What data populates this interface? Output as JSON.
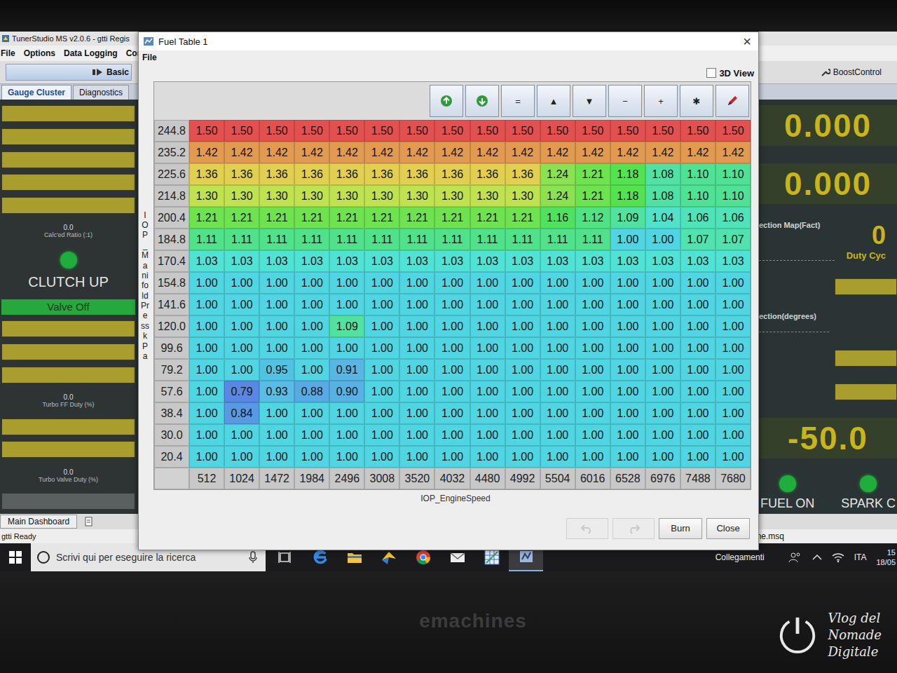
{
  "main_window": {
    "title": "TunerStudio MS v2.0.6 - gtti Regis",
    "menu": [
      "File",
      "Options",
      "Data Logging",
      "Com"
    ],
    "toolbar": {
      "left": "Basic",
      "right": "BoostControl"
    },
    "tabs": [
      {
        "label": "Gauge Cluster",
        "selected": true
      },
      {
        "label": "Diagnostics",
        "selected": false
      }
    ],
    "left_gauges": [
      {
        "kind": "bar"
      },
      {
        "kind": "bar"
      },
      {
        "kind": "bar"
      },
      {
        "kind": "bar"
      },
      {
        "kind": "bar"
      },
      {
        "kind": "readout",
        "value": "0.0",
        "label": "Calc'ed Ratio (:1)"
      },
      {
        "kind": "indicator",
        "label": "CLUTCH UP",
        "on": true
      },
      {
        "kind": "button",
        "label": "Valve Off",
        "on": true
      },
      {
        "kind": "bar"
      },
      {
        "kind": "bar"
      },
      {
        "kind": "bar"
      },
      {
        "kind": "readout",
        "value": "0.0",
        "label": "Turbo FF Duty (%)"
      },
      {
        "kind": "bar"
      },
      {
        "kind": "bar"
      },
      {
        "kind": "readout",
        "value": "0.0",
        "label": "Turbo Valve Duty (%)"
      },
      {
        "kind": "slider"
      }
    ],
    "right_gauges": [
      {
        "kind": "big",
        "value": "0.000"
      },
      {
        "kind": "big",
        "value": "0.000"
      },
      {
        "kind": "pair",
        "label": "ection Map(Fact)",
        "value": "0",
        "sub": "Duty Cyc"
      },
      {
        "kind": "bar"
      },
      {
        "kind": "label",
        "label": "ection(degrees)"
      },
      {
        "kind": "bar"
      },
      {
        "kind": "bar"
      },
      {
        "kind": "big",
        "value": "-50.0"
      },
      {
        "kind": "lights",
        "items": [
          {
            "label": "FUEL ON",
            "on": true
          },
          {
            "label": "SPARK C",
            "on": true
          }
        ]
      }
    ],
    "bottom_tab": "Main Dashboard",
    "status": "gtti Ready",
    "file_name": "une.msq"
  },
  "dialog": {
    "title": "Fuel Table 1",
    "close": "×",
    "menu": [
      "File"
    ],
    "view_3d": {
      "label": "3D View",
      "checked": false
    },
    "tools": [
      {
        "kind": "upload"
      },
      {
        "kind": "download"
      },
      {
        "kind": "glyph",
        "text": "="
      },
      {
        "kind": "glyph",
        "text": "▲"
      },
      {
        "kind": "glyph",
        "text": "▼"
      },
      {
        "kind": "glyph",
        "text": "−"
      },
      {
        "kind": "glyph",
        "text": "+"
      },
      {
        "kind": "glyph",
        "text": "✱"
      },
      {
        "kind": "edit"
      }
    ],
    "table": {
      "y_label": "IOP_ManifoldPress kPa",
      "x_label": "IOP_EngineSpeed",
      "columns": [
        "512",
        "1024",
        "1472",
        "1984",
        "2496",
        "3008",
        "3520",
        "4032",
        "4480",
        "4992",
        "5504",
        "6016",
        "6528",
        "6976",
        "7488",
        "7680"
      ],
      "rows": [
        {
          "label": "244.8",
          "cells": [
            "1.50",
            "1.50",
            "1.50",
            "1.50",
            "1.50",
            "1.50",
            "1.50",
            "1.50",
            "1.50",
            "1.50",
            "1.50",
            "1.50",
            "1.50",
            "1.50",
            "1.50",
            "1.50"
          ]
        },
        {
          "label": "235.2",
          "cells": [
            "1.42",
            "1.42",
            "1.42",
            "1.42",
            "1.42",
            "1.42",
            "1.42",
            "1.42",
            "1.42",
            "1.42",
            "1.42",
            "1.42",
            "1.42",
            "1.42",
            "1.42",
            "1.42"
          ]
        },
        {
          "label": "225.6",
          "cells": [
            "1.36",
            "1.36",
            "1.36",
            "1.36",
            "1.36",
            "1.36",
            "1.36",
            "1.36",
            "1.36",
            "1.36",
            "1.24",
            "1.21",
            "1.18",
            "1.08",
            "1.10",
            "1.10"
          ]
        },
        {
          "label": "214.8",
          "cells": [
            "1.30",
            "1.30",
            "1.30",
            "1.30",
            "1.30",
            "1.30",
            "1.30",
            "1.30",
            "1.30",
            "1.30",
            "1.24",
            "1.21",
            "1.18",
            "1.08",
            "1.10",
            "1.10"
          ]
        },
        {
          "label": "200.4",
          "cells": [
            "1.21",
            "1.21",
            "1.21",
            "1.21",
            "1.21",
            "1.21",
            "1.21",
            "1.21",
            "1.21",
            "1.21",
            "1.16",
            "1.12",
            "1.09",
            "1.04",
            "1.06",
            "1.06"
          ]
        },
        {
          "label": "184.8",
          "cells": [
            "1.11",
            "1.11",
            "1.11",
            "1.11",
            "1.11",
            "1.11",
            "1.11",
            "1.11",
            "1.11",
            "1.11",
            "1.11",
            "1.11",
            "1.00",
            "1.00",
            "1.07",
            "1.07"
          ]
        },
        {
          "label": "170.4",
          "cells": [
            "1.03",
            "1.03",
            "1.03",
            "1.03",
            "1.03",
            "1.03",
            "1.03",
            "1.03",
            "1.03",
            "1.03",
            "1.03",
            "1.03",
            "1.03",
            "1.03",
            "1.03",
            "1.03"
          ]
        },
        {
          "label": "154.8",
          "cells": [
            "1.00",
            "1.00",
            "1.00",
            "1.00",
            "1.00",
            "1.00",
            "1.00",
            "1.00",
            "1.00",
            "1.00",
            "1.00",
            "1.00",
            "1.00",
            "1.00",
            "1.00",
            "1.00"
          ]
        },
        {
          "label": "141.6",
          "cells": [
            "1.00",
            "1.00",
            "1.00",
            "1.00",
            "1.00",
            "1.00",
            "1.00",
            "1.00",
            "1.00",
            "1.00",
            "1.00",
            "1.00",
            "1.00",
            "1.00",
            "1.00",
            "1.00"
          ]
        },
        {
          "label": "120.0",
          "cells": [
            "1.00",
            "1.00",
            "1.00",
            "1.00",
            "1.09",
            "1.00",
            "1.00",
            "1.00",
            "1.00",
            "1.00",
            "1.00",
            "1.00",
            "1.00",
            "1.00",
            "1.00",
            "1.00"
          ]
        },
        {
          "label": "99.6",
          "cells": [
            "1.00",
            "1.00",
            "1.00",
            "1.00",
            "1.00",
            "1.00",
            "1.00",
            "1.00",
            "1.00",
            "1.00",
            "1.00",
            "1.00",
            "1.00",
            "1.00",
            "1.00",
            "1.00"
          ]
        },
        {
          "label": "79.2",
          "cells": [
            "1.00",
            "1.00",
            "0.95",
            "1.00",
            "0.91",
            "1.00",
            "1.00",
            "1.00",
            "1.00",
            "1.00",
            "1.00",
            "1.00",
            "1.00",
            "1.00",
            "1.00",
            "1.00"
          ]
        },
        {
          "label": "57.6",
          "cells": [
            "1.00",
            "0.79",
            "0.93",
            "0.88",
            "0.90",
            "1.00",
            "1.00",
            "1.00",
            "1.00",
            "1.00",
            "1.00",
            "1.00",
            "1.00",
            "1.00",
            "1.00",
            "1.00"
          ]
        },
        {
          "label": "38.4",
          "cells": [
            "1.00",
            "0.84",
            "1.00",
            "1.00",
            "1.00",
            "1.00",
            "1.00",
            "1.00",
            "1.00",
            "1.00",
            "1.00",
            "1.00",
            "1.00",
            "1.00",
            "1.00",
            "1.00"
          ]
        },
        {
          "label": "30.0",
          "cells": [
            "1.00",
            "1.00",
            "1.00",
            "1.00",
            "1.00",
            "1.00",
            "1.00",
            "1.00",
            "1.00",
            "1.00",
            "1.00",
            "1.00",
            "1.00",
            "1.00",
            "1.00",
            "1.00"
          ]
        },
        {
          "label": "20.4",
          "cells": [
            "1.00",
            "1.00",
            "1.00",
            "1.00",
            "1.00",
            "1.00",
            "1.00",
            "1.00",
            "1.00",
            "1.00",
            "1.00",
            "1.00",
            "1.00",
            "1.00",
            "1.00",
            "1.00"
          ]
        }
      ]
    },
    "buttons": [
      {
        "kind": "undo",
        "disabled": true
      },
      {
        "kind": "redo",
        "disabled": true
      },
      {
        "kind": "text",
        "label": "Burn",
        "disabled": false
      },
      {
        "kind": "text",
        "label": "Close",
        "disabled": false
      }
    ]
  },
  "taskbar": {
    "search_placeholder": "Scrivi qui per eseguire la ricerca",
    "apps": [
      {
        "kind": "taskview",
        "selected": false
      },
      {
        "kind": "edge",
        "selected": false
      },
      {
        "kind": "explorer",
        "selected": false
      },
      {
        "kind": "kite",
        "selected": false
      },
      {
        "kind": "chrome",
        "selected": false
      },
      {
        "kind": "mail",
        "selected": false
      },
      {
        "kind": "grid",
        "selected": false
      },
      {
        "kind": "tuner",
        "selected": true
      }
    ],
    "tray": {
      "links": "Collegamenti",
      "language": "ITA",
      "time": "15",
      "date": "18/05"
    }
  },
  "bezel": {
    "brand": "emachines",
    "watermark": [
      "Vlog del",
      "Nomade",
      "Digitale"
    ]
  }
}
